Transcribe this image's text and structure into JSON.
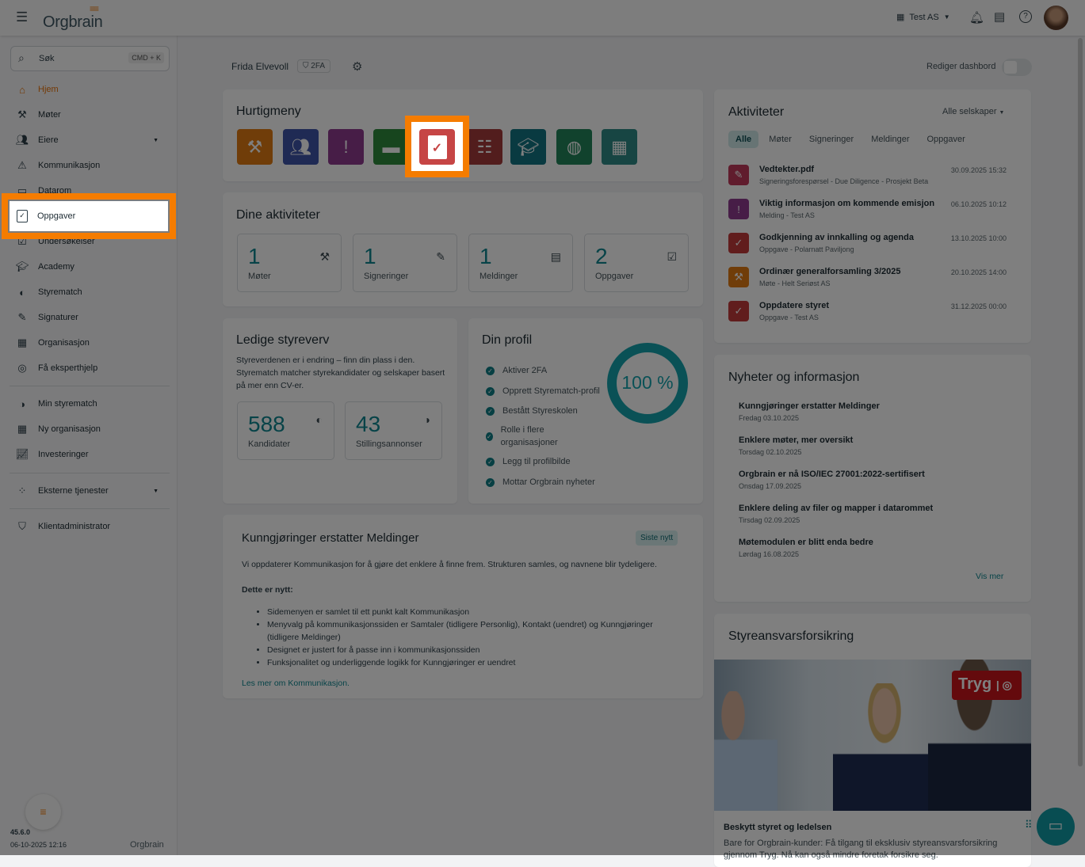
{
  "topbar": {
    "logo": "Orgbrain",
    "company": "Test AS"
  },
  "sidebar": {
    "search_label": "Søk",
    "search_shortcut": "CMD + K",
    "items": [
      {
        "label": "Hjem"
      },
      {
        "label": "Møter"
      },
      {
        "label": "Eiere"
      },
      {
        "label": "Kommunikasjon"
      },
      {
        "label": "Datarom"
      },
      {
        "label": "Oppgaver"
      },
      {
        "label": "Undersøkelser"
      },
      {
        "label": "Academy"
      },
      {
        "label": "Styrematch"
      },
      {
        "label": "Signaturer"
      },
      {
        "label": "Organisasjon"
      },
      {
        "label": "Få eksperthjelp"
      },
      {
        "label": "Min styrematch"
      },
      {
        "label": "Ny organisasjon"
      },
      {
        "label": "Investeringer"
      },
      {
        "label": "Eksterne tjenester"
      },
      {
        "label": "Klientadministrator"
      }
    ],
    "version": "45.6.0",
    "build_time": "06-10-2025 12:16",
    "footer_logo": "Orgbrain"
  },
  "header": {
    "user": "Frida Elvevoll",
    "badge": "2FA",
    "edit_dashboard": "Rediger dashbord"
  },
  "quickmenu": {
    "title": "Hurtigmeny",
    "icons": [
      "meetings",
      "owners",
      "communication",
      "dataroom",
      "tasks",
      "surveys",
      "academy",
      "styrematch",
      "organisation"
    ]
  },
  "activities_summary": {
    "title": "Dine aktiviteter",
    "items": [
      {
        "count": "1",
        "label": "Møter"
      },
      {
        "count": "1",
        "label": "Signeringer"
      },
      {
        "count": "1",
        "label": "Meldinger"
      },
      {
        "count": "2",
        "label": "Oppgaver"
      }
    ]
  },
  "board": {
    "title": "Ledige styreverv",
    "text": "Styreverdenen er i endring – finn din plass i den. Styrematch matcher styrekandidater og selskaper basert på mer enn CV-er.",
    "stats": [
      {
        "count": "588",
        "label": "Kandidater"
      },
      {
        "count": "43",
        "label": "Stillingsannonser"
      }
    ]
  },
  "profile": {
    "title": "Din profil",
    "progress_label": "100 %",
    "progress": 100,
    "items": [
      "Aktiver 2FA",
      "Opprett Styrematch-profil",
      "Bestått Styreskolen",
      "Rolle i flere organisasjoner",
      "Legg til profilbilde",
      "Mottar Orgbrain nyheter"
    ]
  },
  "announcement": {
    "title": "Kunngjøringer erstatter Meldinger",
    "badge": "Siste nytt",
    "intro": "Vi oppdaterer Kommunikasjon for å gjøre det enklere å finne frem. Strukturen samles, og navnene blir tydeligere.",
    "subtitle": "Dette er nytt:",
    "bullets": [
      "Sidemenyen er samlet til ett punkt kalt Kommunikasjon",
      "Menyvalg på kommunikasjonssiden er Samtaler (tidligere Personlig), Kontakt (uendret) og Kunngjøringer (tidligere Meldinger)",
      "Designet er justert for å passe inn i kommunikasjonssiden",
      "Funksjonalitet og underliggende logikk for Kunngjøringer er uendret"
    ],
    "link": "Les mer om Kommunikasjon."
  },
  "activities": {
    "title": "Aktiviteter",
    "filter": "Alle selskaper",
    "tabs": [
      "Alle",
      "Møter",
      "Signeringer",
      "Meldinger",
      "Oppgaver"
    ],
    "items": [
      {
        "title": "Vedtekter.pdf",
        "sub": "Signeringsforespørsel - Due Diligence - Prosjekt Beta",
        "date": "30.09.2025 15:32",
        "color": "#c0395a"
      },
      {
        "title": "Viktig informasjon om kommende emisjon",
        "sub": "Melding - Test AS",
        "date": "06.10.2025 10:12",
        "color": "#8e3a8f"
      },
      {
        "title": "Godkjenning av innkalling og agenda",
        "sub": "Oppgave - Polarnatt Paviljong",
        "date": "13.10.2025 10:00",
        "color": "#c23b3b"
      },
      {
        "title": "Ordinær generalforsamling 3/2025",
        "sub": "Møte - Helt Seriøst AS",
        "date": "20.10.2025 14:00",
        "color": "#e07b12"
      },
      {
        "title": "Oppdatere styret",
        "sub": "Oppgave - Test AS",
        "date": "31.12.2025 00:00",
        "color": "#c23b3b"
      }
    ]
  },
  "news": {
    "title": "Nyheter og informasjon",
    "more": "Vis mer",
    "items": [
      {
        "title": "Kunngjøringer erstatter Meldinger",
        "date": "Fredag 03.10.2025"
      },
      {
        "title": "Enklere møter, mer oversikt",
        "date": "Torsdag 02.10.2025"
      },
      {
        "title": "Orgbrain er nå ISO/IEC 27001:2022-sertifisert",
        "date": "Onsdag 17.09.2025"
      },
      {
        "title": "Enklere deling av filer og mapper i datarommet",
        "date": "Tirsdag 02.09.2025"
      },
      {
        "title": "Møtemodulen er blitt enda bedre",
        "date": "Lørdag 16.08.2025"
      }
    ]
  },
  "insurance": {
    "title": "Styreansvarsforsikring",
    "brand": "Tryg",
    "subtitle": "Beskytt styret og ledelsen",
    "text": "Bare for Orgbrain-kunder: Få tilgang til eksklusiv styreansvarsforsikring gjennom Tryg. Nå kan også mindre foretak forsikre seg."
  },
  "colors": {
    "accent": "#f57c00",
    "teal": "#0f8790"
  }
}
